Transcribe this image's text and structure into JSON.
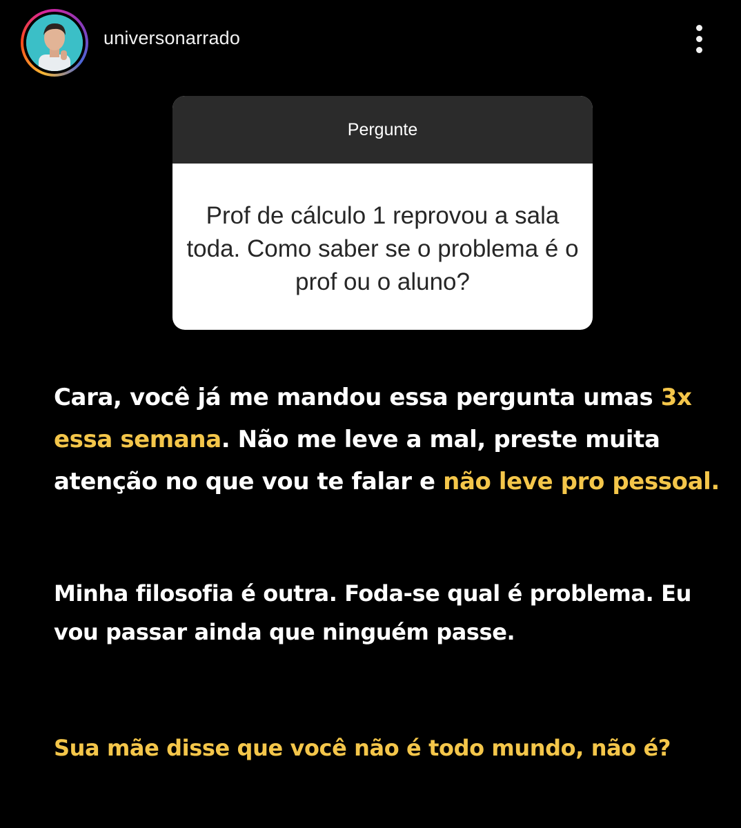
{
  "header": {
    "username": "universonarrado",
    "avatar_icon": "profile-avatar",
    "more_icon": "more-vertical-icon"
  },
  "question_box": {
    "title": "Pergunte",
    "question": "Prof de cálculo 1 reprovou a sala toda. Como saber se o problema é o prof ou o aluno?"
  },
  "answer": {
    "p1_a": "Cara, você já me mandou essa pergunta umas ",
    "p1_highlight_1": "3x essa semana",
    "p1_b": ". Não me leve a mal, preste muita atenção no que vou te falar e ",
    "p1_highlight_2": "não leve pro pessoal.",
    "p2": "Minha filosofia é outra. Foda-se qual é problema. Eu vou passar ainda que ninguém passe.",
    "p3": "Sua mãe disse que você não é todo mundo, não é?"
  },
  "colors": {
    "background": "#000000",
    "highlight": "#f4c64a",
    "box_header": "#2b2b2b"
  }
}
